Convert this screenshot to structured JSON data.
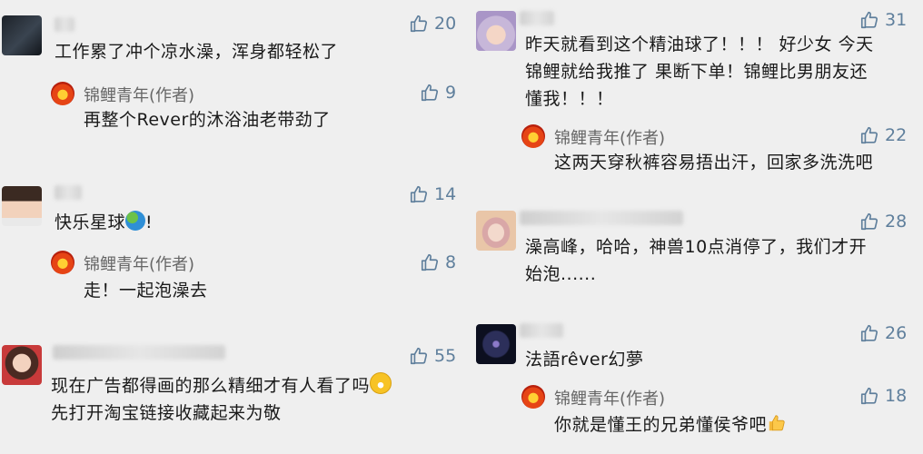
{
  "thumb_color": "#5f7f9c",
  "left": [
    {
      "comment": {
        "lines": [
          "工作累了冲个凉水澡，浑身都轻松了"
        ],
        "likes": "20"
      },
      "reply": {
        "author": "锦鲤青年(作者)",
        "lines": [
          "再整个Rever的沐浴油老带劲了"
        ],
        "likes": "9"
      }
    },
    {
      "comment": {
        "lines": [
          "快乐星球"
        ],
        "suffix": "!",
        "emoji": "globe-emoji",
        "likes": "14"
      },
      "reply": {
        "author": "锦鲤青年(作者)",
        "lines": [
          "走！一起泡澡去"
        ],
        "likes": "8"
      }
    },
    {
      "comment": {
        "lines": [
          "现在广告都得画的那么精细才有人看了吗",
          "先打开淘宝链接收藏起来为敬"
        ],
        "emoji": "laughing-tears-emoji",
        "likes": "55"
      }
    }
  ],
  "right": [
    {
      "comment": {
        "lines": [
          "昨天就看到这个精油球了！！！ 好少女 今天",
          "锦鲤就给我推了 果断下单！锦鲤比男朋友还",
          "懂我！！！"
        ],
        "likes": "31"
      },
      "reply": {
        "author": "锦鲤青年(作者)",
        "lines": [
          "这两天穿秋裤容易捂出汗，回家多洗洗吧"
        ],
        "likes": "22"
      }
    },
    {
      "comment": {
        "lines": [
          "澡高峰，哈哈，神兽10点消停了，我们才开",
          "始泡......"
        ],
        "likes": "28"
      }
    },
    {
      "comment": {
        "lines": [
          "法語rêver幻夢"
        ],
        "likes": "26"
      },
      "reply": {
        "author": "锦鲤青年(作者)",
        "lines": [
          "你就是懂王的兄弟懂侯爷吧"
        ],
        "emoji": "thumbs-up-emoji",
        "likes": "18"
      }
    }
  ]
}
